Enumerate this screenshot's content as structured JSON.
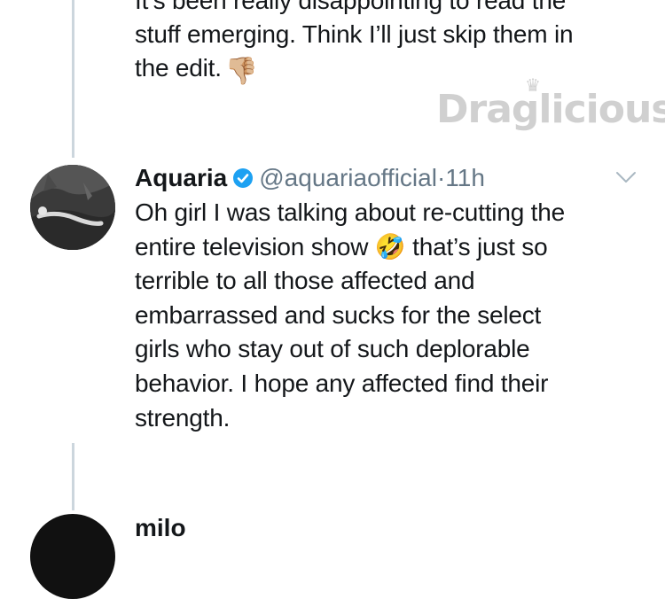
{
  "previous_tweet": {
    "lines": [
      "It’s been really disappointing to read the",
      "stuff emerging. Think I’ll just skip them in",
      "the edit."
    ],
    "emoji": "👎🏼",
    "emoji_icon": "thumbs-down-icon"
  },
  "watermark": {
    "text": "Draglicious"
  },
  "tweet": {
    "display_name": "Aquaria",
    "verified": true,
    "handle": "@aquariaofficial",
    "separator": "·",
    "time": "11h",
    "body": {
      "line1": "Oh girl I was talking about re-cutting the",
      "line2_before": "entire television show",
      "line2_emoji": "🤣",
      "line2_after": "that’s just so",
      "line3": "terrible to all those affected and",
      "line4": "embarrassed and sucks for the select",
      "line5": "girls who stay out of such deplorable",
      "line6": "behavior. I hope any affected find their",
      "line7": "strength."
    }
  },
  "next_tweet": {
    "display_name": "milo"
  },
  "colors": {
    "text": "#14171a",
    "muted": "#657786",
    "verified": "#1da1f2",
    "thread_line": "#ccd6dd"
  }
}
